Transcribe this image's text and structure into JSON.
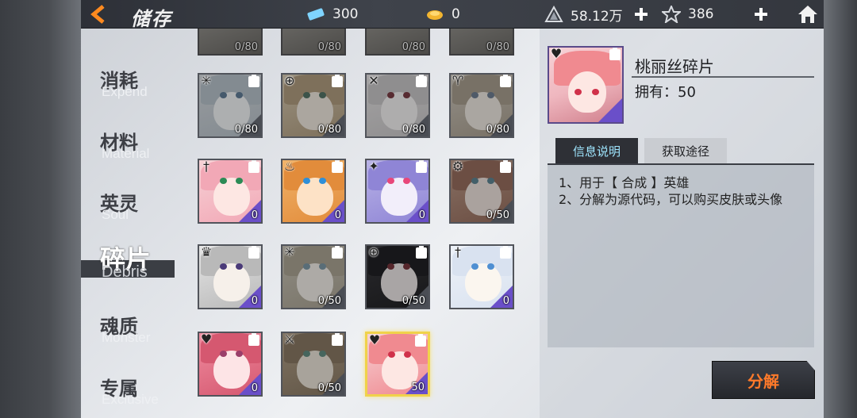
{
  "header": {
    "title": "储存",
    "tickets": "300",
    "gold": "0",
    "power": "58.12万",
    "stars": "386"
  },
  "categories": [
    {
      "zh": "消耗",
      "en": "Expend"
    },
    {
      "zh": "材料",
      "en": "Material"
    },
    {
      "zh": "英灵",
      "en": "Soul"
    },
    {
      "zh": "碎片",
      "en": "Debris"
    },
    {
      "zh": "魂质",
      "en": "Monster"
    },
    {
      "zh": "专属",
      "en": "Exclusive"
    }
  ],
  "active_category": "Debris",
  "top_row_counts": [
    "0/80",
    "0/80",
    "0/80",
    "0/80"
  ],
  "grid": [
    {
      "count": "0/80",
      "element": "cross"
    },
    {
      "count": "0/80",
      "element": "shield"
    },
    {
      "count": "0/80",
      "element": "dagger-x"
    },
    {
      "count": "0/80",
      "element": "horn"
    },
    {
      "count": "0",
      "element": "sword"
    },
    {
      "count": "0",
      "element": "flame"
    },
    {
      "count": "0",
      "element": "shuriken"
    },
    {
      "count": "0/50",
      "element": "gear"
    },
    {
      "count": "0",
      "element": "hat"
    },
    {
      "count": "0/50",
      "element": "cross"
    },
    {
      "count": "0/50",
      "element": "shield"
    },
    {
      "count": "0",
      "element": "sword"
    },
    {
      "count": "0",
      "element": "heart-skull"
    },
    {
      "count": "0/50",
      "element": "dagger"
    },
    {
      "count": "50",
      "element": "heart-skull"
    }
  ],
  "detail": {
    "name": "桃丽丝碎片",
    "owned": "拥有：50",
    "tab_info": "信息说明",
    "tab_source": "获取途径",
    "line1": "1、用于【 合成 】英雄",
    "line2": "2、分解为源代码，可以购买皮肤或头像"
  },
  "decompose_label": "分解",
  "colors": {
    "accent": "#ff7a2a",
    "selected_border": "#f0d24a",
    "tab_active_text": "#9fe6ff",
    "rare_tag": "#6a4fc9"
  }
}
